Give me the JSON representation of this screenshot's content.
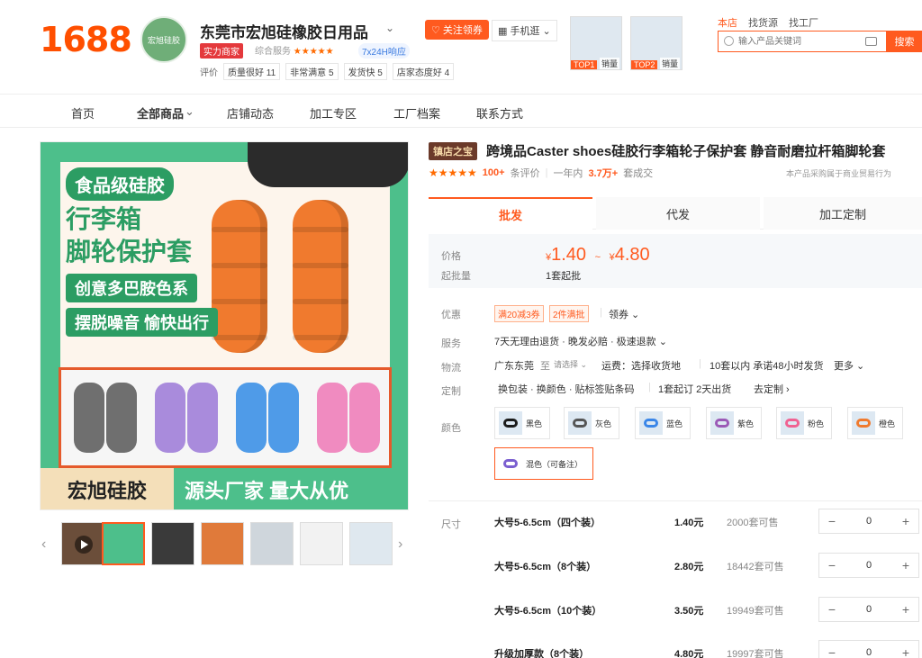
{
  "header": {
    "logo": "1688",
    "avatar_text": "宏旭硅胶",
    "shop_name": "东莞市宏旭硅橡胶日用品",
    "badge_real": "实力商家",
    "overall_label": "综合服务",
    "overall_stars": "★★★★★",
    "badge_24h": "7x24H响应",
    "ratings_label": "评价",
    "ratings": [
      "质量很好 11",
      "非常满意 5",
      "发货快 5",
      "店家态度好 4"
    ],
    "follow_btn": "关注领券",
    "mobile_btn": "手机逛",
    "top_items": [
      {
        "tag": "TOP1",
        "label": "销量"
      },
      {
        "tag": "TOP2",
        "label": "销量"
      }
    ],
    "scope_tabs": [
      "本店",
      "找货源",
      "找工厂"
    ],
    "search_placeholder": "输入产品关键词",
    "search_btn": "搜索"
  },
  "nav": [
    "首页",
    "全部商品",
    "店铺动态",
    "加工专区",
    "工厂档案",
    "联系方式"
  ],
  "gallery": {
    "tag_food": "食品级硅胶",
    "title_1": "行李箱",
    "title_2": "脚轮保护套",
    "pill_1": "创意多巴胺色系",
    "pill_2": "摆脱噪音 愉快出行",
    "band_left": "宏旭硅胶",
    "band_right": "源头厂家  量大从优"
  },
  "product": {
    "shop_badge": "镇店之宝",
    "title": "跨境品Caster shoes硅胶行李箱轮子保护套 静音耐磨拉杆箱脚轮套",
    "stars": "★★★★★",
    "review_count": "100+",
    "review_suffix": "条评价",
    "year_label": "一年内",
    "sold": "3.7万+",
    "sold_suffix": "套成交",
    "notice": "本产品采购属于商业贸易行为"
  },
  "tabs": [
    "批发",
    "代发",
    "加工定制"
  ],
  "price": {
    "label": "价格",
    "currency": "¥",
    "low": "1.40",
    "sep": "~",
    "high": "4.80",
    "moq_label": "起批量",
    "moq": "1套起批"
  },
  "promo": {
    "label": "优惠",
    "coupons": [
      "满20减3券",
      "2件满批"
    ],
    "get": "领券"
  },
  "service": {
    "label": "服务",
    "value": "7天无理由退货 · 晚发必赔 · 极速退款"
  },
  "logistics": {
    "label": "物流",
    "from": "广东东莞",
    "to_label": "至",
    "to": "请选择",
    "fee": "运费：选择收货地",
    "ship": "10套以内  承诺48小时发货",
    "more": "更多"
  },
  "custom": {
    "label": "定制",
    "value": "换包装 · 换颜色 · 贴标签贴条码",
    "moq": "1套起订  2天出货",
    "link": "去定制"
  },
  "colors": {
    "label": "颜色",
    "options": [
      {
        "name": "黑色",
        "color": "#1a1a1a"
      },
      {
        "name": "灰色",
        "color": "#555555"
      },
      {
        "name": "蓝色",
        "color": "#3a86e8"
      },
      {
        "name": "紫色",
        "color": "#9b59b6"
      },
      {
        "name": "粉色",
        "color": "#f06292"
      },
      {
        "name": "橙色",
        "color": "#f07a2e"
      },
      {
        "name": "混色（可备注）",
        "color": "#7b5fd0"
      }
    ]
  },
  "size": {
    "label": "尺寸",
    "rows": [
      {
        "name": "大号5-6.5cm（四个装）",
        "price": "1.40元",
        "stock": "2000套可售",
        "qty": "0"
      },
      {
        "name": "大号5-6.5cm（8个装）",
        "price": "2.80元",
        "stock": "18442套可售",
        "qty": "0"
      },
      {
        "name": "大号5-6.5cm（10个装）",
        "price": "3.50元",
        "stock": "19949套可售",
        "qty": "0"
      },
      {
        "name": "升级加厚款（8个装）",
        "price": "4.80元",
        "stock": "19997套可售",
        "qty": "0"
      }
    ]
  },
  "stepper": {
    "minus": "−",
    "plus": "+"
  },
  "colors_theme": {
    "brand": "#ff5a1f",
    "green": "#2c9d63"
  }
}
